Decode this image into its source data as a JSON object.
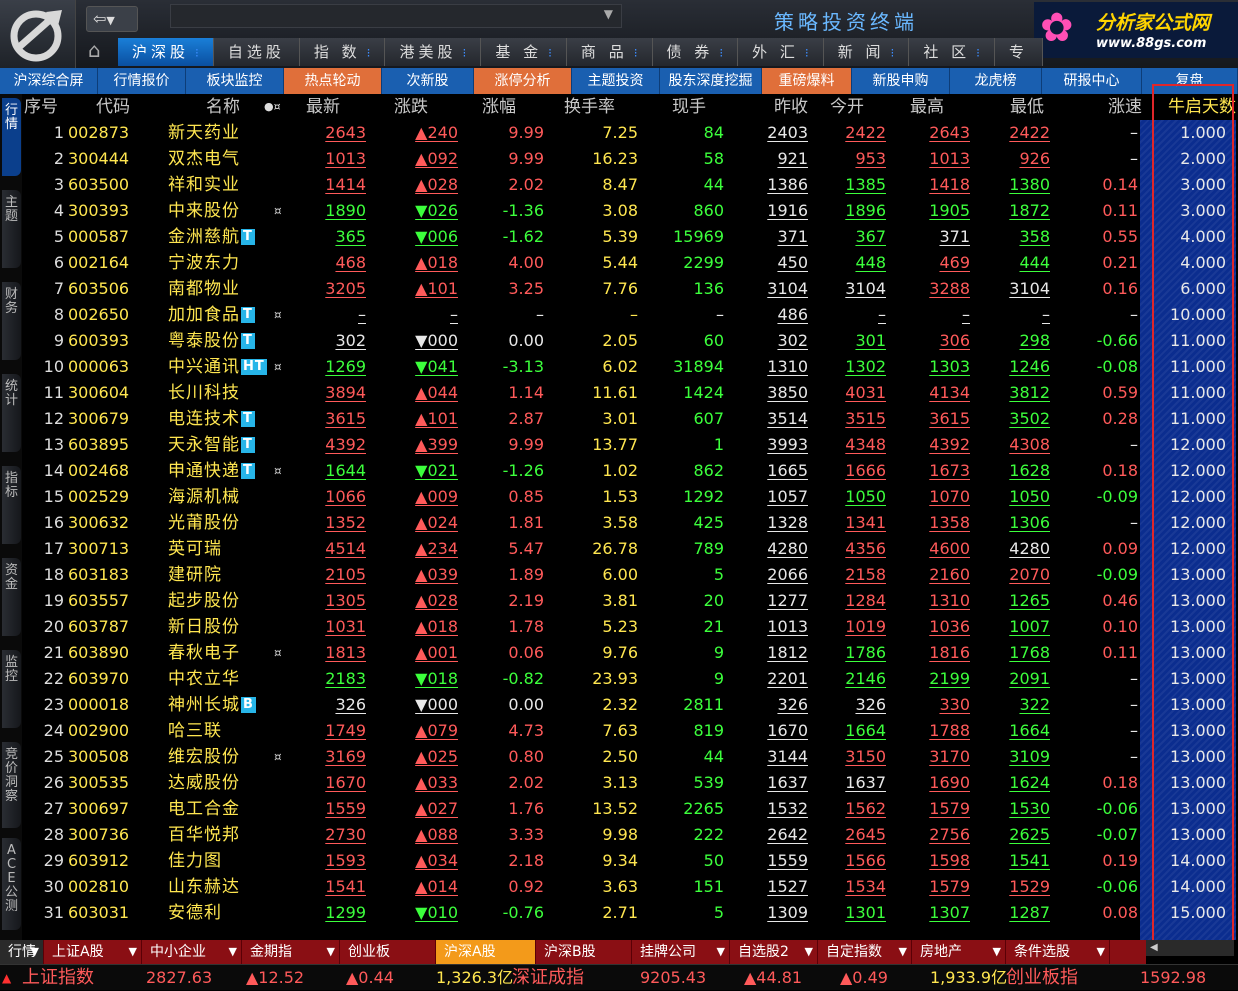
{
  "titlebar": {
    "terminal_title": "策略投资终端",
    "brand_name": "分析家公式网",
    "brand_url": "www.88gs.com"
  },
  "main_tabs": [
    {
      "label": "沪深股",
      "active": true,
      "menu": true
    },
    {
      "label": "自选股",
      "active": false,
      "menu": false
    },
    {
      "label": "指 数",
      "active": false,
      "menu": true
    },
    {
      "label": "港美股",
      "active": false,
      "menu": true
    },
    {
      "label": "基 金",
      "active": false,
      "menu": true
    },
    {
      "label": "商 品",
      "active": false,
      "menu": true
    },
    {
      "label": "债 券",
      "active": false,
      "menu": true
    },
    {
      "label": "外 汇",
      "active": false,
      "menu": true
    },
    {
      "label": "新 闻",
      "active": false,
      "menu": true
    },
    {
      "label": "社 区",
      "active": false,
      "menu": true
    },
    {
      "label": "专",
      "active": false,
      "menu": false
    }
  ],
  "sub_nav": [
    {
      "label": "沪深综合屏",
      "hot": false
    },
    {
      "label": "行情报价",
      "hot": false
    },
    {
      "label": "板块监控",
      "hot": false
    },
    {
      "label": "热点轮动",
      "hot": true
    },
    {
      "label": "次新股",
      "hot": false
    },
    {
      "label": "涨停分析",
      "hot": true
    },
    {
      "label": "主题投资",
      "hot": false
    },
    {
      "label": "股东深度挖掘",
      "hot": false
    },
    {
      "label": "重磅爆料",
      "hot": true
    },
    {
      "label": "新股申购",
      "hot": false
    },
    {
      "label": "龙虎榜",
      "hot": false
    },
    {
      "label": "研报中心",
      "hot": false
    },
    {
      "label": "复盘",
      "hot": false
    }
  ],
  "side_tabs": [
    "行情",
    "主题",
    "财务",
    "统计",
    "指标",
    "资金",
    "监控",
    "竞价洞察",
    "ACE公测"
  ],
  "columns": [
    "序号",
    "代码",
    "名称",
    "最新",
    "涨跌",
    "涨幅",
    "换手率",
    "现手",
    "昨收",
    "今开",
    "最高",
    "最低",
    "涨速",
    "牛启天数↑"
  ],
  "rows": [
    {
      "i": "1",
      "code": "002873",
      "name": "新天药业",
      "tag": "",
      "star": false,
      "last": "2643",
      "chg": "▲240",
      "pct": "9.99",
      "turn": "7.25",
      "vol": "84",
      "prev": "2403",
      "open": "2422",
      "high": "2643",
      "low": "2422",
      "speed": "–",
      "days": "1.000",
      "dir": "up",
      "oc": "up",
      "hc": "up",
      "lc": "up"
    },
    {
      "i": "2",
      "code": "300444",
      "name": "双杰电气",
      "tag": "",
      "star": false,
      "last": "1013",
      "chg": "▲092",
      "pct": "9.99",
      "turn": "16.23",
      "vol": "58",
      "prev": "921",
      "open": "953",
      "high": "1013",
      "low": "926",
      "speed": "–",
      "days": "2.000",
      "dir": "up",
      "oc": "up",
      "hc": "up",
      "lc": "up"
    },
    {
      "i": "3",
      "code": "603500",
      "name": "祥和实业",
      "tag": "",
      "star": false,
      "last": "1414",
      "chg": "▲028",
      "pct": "2.02",
      "turn": "8.47",
      "vol": "44",
      "prev": "1386",
      "open": "1385",
      "high": "1418",
      "low": "1380",
      "speed": "0.14",
      "days": "3.000",
      "dir": "up",
      "oc": "dn",
      "hc": "up",
      "lc": "dn"
    },
    {
      "i": "4",
      "code": "300393",
      "name": "中来股份",
      "tag": "",
      "star": true,
      "last": "1890",
      "chg": "▼026",
      "pct": "-1.36",
      "turn": "3.08",
      "vol": "860",
      "prev": "1916",
      "open": "1896",
      "high": "1905",
      "low": "1872",
      "speed": "0.11",
      "days": "3.000",
      "dir": "dn",
      "oc": "dn",
      "hc": "dn",
      "lc": "dn"
    },
    {
      "i": "5",
      "code": "000587",
      "name": "金洲慈航",
      "tag": "T",
      "star": false,
      "last": "365",
      "chg": "▼006",
      "pct": "-1.62",
      "turn": "5.39",
      "vol": "15969",
      "prev": "371",
      "open": "367",
      "high": "371",
      "low": "358",
      "speed": "0.55",
      "days": "4.000",
      "dir": "dn",
      "oc": "dn",
      "hc": "wh",
      "lc": "dn"
    },
    {
      "i": "6",
      "code": "002164",
      "name": "宁波东力",
      "tag": "",
      "star": false,
      "last": "468",
      "chg": "▲018",
      "pct": "4.00",
      "turn": "5.44",
      "vol": "2299",
      "prev": "450",
      "open": "448",
      "high": "469",
      "low": "444",
      "speed": "0.21",
      "days": "4.000",
      "dir": "up",
      "oc": "dn",
      "hc": "up",
      "lc": "dn"
    },
    {
      "i": "7",
      "code": "603506",
      "name": "南都物业",
      "tag": "",
      "star": false,
      "last": "3205",
      "chg": "▲101",
      "pct": "3.25",
      "turn": "7.76",
      "vol": "136",
      "prev": "3104",
      "open": "3104",
      "high": "3288",
      "low": "3104",
      "speed": "0.16",
      "days": "6.000",
      "dir": "up",
      "oc": "wh",
      "hc": "up",
      "lc": "wh"
    },
    {
      "i": "8",
      "code": "002650",
      "name": "加加食品",
      "tag": "T",
      "star": true,
      "last": "–",
      "chg": "–",
      "pct": "–",
      "turn": "–",
      "vol": "–",
      "prev": "486",
      "open": "–",
      "high": "–",
      "low": "–",
      "speed": "–",
      "days": "10.000",
      "dir": "wh",
      "oc": "wh",
      "hc": "wh",
      "lc": "wh"
    },
    {
      "i": "9",
      "code": "600393",
      "name": "粤泰股份",
      "tag": "T",
      "star": false,
      "last": "302",
      "chg": "▼000",
      "pct": "0.00",
      "turn": "2.05",
      "vol": "60",
      "prev": "302",
      "open": "301",
      "high": "306",
      "low": "298",
      "speed": "-0.66",
      "days": "11.000",
      "dir": "wh",
      "oc": "dn",
      "hc": "up",
      "lc": "dn"
    },
    {
      "i": "10",
      "code": "000063",
      "name": "中兴通讯",
      "tag": "HT",
      "star": true,
      "last": "1269",
      "chg": "▼041",
      "pct": "-3.13",
      "turn": "6.02",
      "vol": "31894",
      "prev": "1310",
      "open": "1302",
      "high": "1303",
      "low": "1246",
      "speed": "-0.08",
      "days": "11.000",
      "dir": "dn",
      "oc": "dn",
      "hc": "dn",
      "lc": "dn"
    },
    {
      "i": "11",
      "code": "300604",
      "name": "长川科技",
      "tag": "",
      "star": false,
      "last": "3894",
      "chg": "▲044",
      "pct": "1.14",
      "turn": "11.61",
      "vol": "1424",
      "prev": "3850",
      "open": "4031",
      "high": "4134",
      "low": "3812",
      "speed": "0.59",
      "days": "11.000",
      "dir": "up",
      "oc": "up",
      "hc": "up",
      "lc": "dn"
    },
    {
      "i": "12",
      "code": "300679",
      "name": "电连技术",
      "tag": "T",
      "star": false,
      "last": "3615",
      "chg": "▲101",
      "pct": "2.87",
      "turn": "3.01",
      "vol": "607",
      "prev": "3514",
      "open": "3515",
      "high": "3615",
      "low": "3502",
      "speed": "0.28",
      "days": "11.000",
      "dir": "up",
      "oc": "up",
      "hc": "up",
      "lc": "dn"
    },
    {
      "i": "13",
      "code": "603895",
      "name": "天永智能",
      "tag": "T",
      "star": false,
      "last": "4392",
      "chg": "▲399",
      "pct": "9.99",
      "turn": "13.77",
      "vol": "1",
      "prev": "3993",
      "open": "4348",
      "high": "4392",
      "low": "4308",
      "speed": "–",
      "days": "12.000",
      "dir": "up",
      "oc": "up",
      "hc": "up",
      "lc": "up"
    },
    {
      "i": "14",
      "code": "002468",
      "name": "申通快递",
      "tag": "T",
      "star": true,
      "last": "1644",
      "chg": "▼021",
      "pct": "-1.26",
      "turn": "1.02",
      "vol": "862",
      "prev": "1665",
      "open": "1666",
      "high": "1673",
      "low": "1628",
      "speed": "0.18",
      "days": "12.000",
      "dir": "dn",
      "oc": "up",
      "hc": "up",
      "lc": "dn"
    },
    {
      "i": "15",
      "code": "002529",
      "name": "海源机械",
      "tag": "",
      "star": false,
      "last": "1066",
      "chg": "▲009",
      "pct": "0.85",
      "turn": "1.53",
      "vol": "1292",
      "prev": "1057",
      "open": "1050",
      "high": "1070",
      "low": "1050",
      "speed": "-0.09",
      "days": "12.000",
      "dir": "up",
      "oc": "dn",
      "hc": "up",
      "lc": "dn"
    },
    {
      "i": "16",
      "code": "300632",
      "name": "光莆股份",
      "tag": "",
      "star": false,
      "last": "1352",
      "chg": "▲024",
      "pct": "1.81",
      "turn": "3.58",
      "vol": "425",
      "prev": "1328",
      "open": "1341",
      "high": "1358",
      "low": "1306",
      "speed": "–",
      "days": "12.000",
      "dir": "up",
      "oc": "up",
      "hc": "up",
      "lc": "dn"
    },
    {
      "i": "17",
      "code": "300713",
      "name": "英可瑞",
      "tag": "",
      "star": false,
      "last": "4514",
      "chg": "▲234",
      "pct": "5.47",
      "turn": "26.78",
      "vol": "789",
      "prev": "4280",
      "open": "4356",
      "high": "4600",
      "low": "4280",
      "speed": "0.09",
      "days": "12.000",
      "dir": "up",
      "oc": "up",
      "hc": "up",
      "lc": "wh"
    },
    {
      "i": "18",
      "code": "603183",
      "name": "建研院",
      "tag": "",
      "star": false,
      "last": "2105",
      "chg": "▲039",
      "pct": "1.89",
      "turn": "6.00",
      "vol": "5",
      "prev": "2066",
      "open": "2158",
      "high": "2160",
      "low": "2070",
      "speed": "-0.09",
      "days": "13.000",
      "dir": "up",
      "oc": "up",
      "hc": "up",
      "lc": "up"
    },
    {
      "i": "19",
      "code": "603557",
      "name": "起步股份",
      "tag": "",
      "star": false,
      "last": "1305",
      "chg": "▲028",
      "pct": "2.19",
      "turn": "3.81",
      "vol": "20",
      "prev": "1277",
      "open": "1284",
      "high": "1310",
      "low": "1265",
      "speed": "0.46",
      "days": "13.000",
      "dir": "up",
      "oc": "up",
      "hc": "up",
      "lc": "dn"
    },
    {
      "i": "20",
      "code": "603787",
      "name": "新日股份",
      "tag": "",
      "star": false,
      "last": "1031",
      "chg": "▲018",
      "pct": "1.78",
      "turn": "5.23",
      "vol": "21",
      "prev": "1013",
      "open": "1019",
      "high": "1036",
      "low": "1007",
      "speed": "0.10",
      "days": "13.000",
      "dir": "up",
      "oc": "up",
      "hc": "up",
      "lc": "dn"
    },
    {
      "i": "21",
      "code": "603890",
      "name": "春秋电子",
      "tag": "",
      "star": true,
      "last": "1813",
      "chg": "▲001",
      "pct": "0.06",
      "turn": "9.76",
      "vol": "9",
      "prev": "1812",
      "open": "1786",
      "high": "1816",
      "low": "1768",
      "speed": "0.11",
      "days": "13.000",
      "dir": "up",
      "oc": "dn",
      "hc": "up",
      "lc": "dn"
    },
    {
      "i": "22",
      "code": "603970",
      "name": "中农立华",
      "tag": "",
      "star": false,
      "last": "2183",
      "chg": "▼018",
      "pct": "-0.82",
      "turn": "23.93",
      "vol": "9",
      "prev": "2201",
      "open": "2146",
      "high": "2199",
      "low": "2091",
      "speed": "–",
      "days": "13.000",
      "dir": "dn",
      "oc": "dn",
      "hc": "dn",
      "lc": "dn"
    },
    {
      "i": "23",
      "code": "000018",
      "name": "神州长城",
      "tag": "B",
      "star": false,
      "last": "326",
      "chg": "▼000",
      "pct": "0.00",
      "turn": "2.32",
      "vol": "2811",
      "prev": "326",
      "open": "326",
      "high": "330",
      "low": "322",
      "speed": "–",
      "days": "13.000",
      "dir": "wh",
      "oc": "wh",
      "hc": "up",
      "lc": "dn"
    },
    {
      "i": "24",
      "code": "002900",
      "name": "哈三联",
      "tag": "",
      "star": false,
      "last": "1749",
      "chg": "▲079",
      "pct": "4.73",
      "turn": "7.63",
      "vol": "819",
      "prev": "1670",
      "open": "1664",
      "high": "1788",
      "low": "1664",
      "speed": "–",
      "days": "13.000",
      "dir": "up",
      "oc": "dn",
      "hc": "up",
      "lc": "dn"
    },
    {
      "i": "25",
      "code": "300508",
      "name": "维宏股份",
      "tag": "",
      "star": true,
      "last": "3169",
      "chg": "▲025",
      "pct": "0.80",
      "turn": "2.50",
      "vol": "44",
      "prev": "3144",
      "open": "3150",
      "high": "3170",
      "low": "3109",
      "speed": "–",
      "days": "13.000",
      "dir": "up",
      "oc": "up",
      "hc": "up",
      "lc": "dn"
    },
    {
      "i": "26",
      "code": "300535",
      "name": "达威股份",
      "tag": "",
      "star": false,
      "last": "1670",
      "chg": "▲033",
      "pct": "2.02",
      "turn": "3.13",
      "vol": "539",
      "prev": "1637",
      "open": "1637",
      "high": "1690",
      "low": "1624",
      "speed": "0.18",
      "days": "13.000",
      "dir": "up",
      "oc": "wh",
      "hc": "up",
      "lc": "dn"
    },
    {
      "i": "27",
      "code": "300697",
      "name": "电工合金",
      "tag": "",
      "star": false,
      "last": "1559",
      "chg": "▲027",
      "pct": "1.76",
      "turn": "13.52",
      "vol": "2265",
      "prev": "1532",
      "open": "1562",
      "high": "1579",
      "low": "1530",
      "speed": "-0.06",
      "days": "13.000",
      "dir": "up",
      "oc": "up",
      "hc": "up",
      "lc": "dn"
    },
    {
      "i": "28",
      "code": "300736",
      "name": "百华悦邦",
      "tag": "",
      "star": false,
      "last": "2730",
      "chg": "▲088",
      "pct": "3.33",
      "turn": "9.98",
      "vol": "222",
      "prev": "2642",
      "open": "2645",
      "high": "2756",
      "low": "2625",
      "speed": "-0.07",
      "days": "13.000",
      "dir": "up",
      "oc": "up",
      "hc": "up",
      "lc": "dn"
    },
    {
      "i": "29",
      "code": "603912",
      "name": "佳力图",
      "tag": "",
      "star": false,
      "last": "1593",
      "chg": "▲034",
      "pct": "2.18",
      "turn": "9.34",
      "vol": "50",
      "prev": "1559",
      "open": "1566",
      "high": "1598",
      "low": "1541",
      "speed": "0.19",
      "days": "14.000",
      "dir": "up",
      "oc": "up",
      "hc": "up",
      "lc": "dn"
    },
    {
      "i": "30",
      "code": "002810",
      "name": "山东赫达",
      "tag": "",
      "star": false,
      "last": "1541",
      "chg": "▲014",
      "pct": "0.92",
      "turn": "3.63",
      "vol": "151",
      "prev": "1527",
      "open": "1534",
      "high": "1579",
      "low": "1529",
      "speed": "-0.06",
      "days": "14.000",
      "dir": "up",
      "oc": "up",
      "hc": "up",
      "lc": "up"
    },
    {
      "i": "31",
      "code": "603031",
      "name": "安德利",
      "tag": "",
      "star": false,
      "last": "1299",
      "chg": "▼010",
      "pct": "-0.76",
      "turn": "2.71",
      "vol": "5",
      "prev": "1309",
      "open": "1301",
      "high": "1307",
      "low": "1287",
      "speed": "0.08",
      "days": "15.000",
      "dir": "dn",
      "oc": "dn",
      "hc": "dn",
      "lc": "dn"
    }
  ],
  "bottom_tabs": [
    {
      "label": "行情",
      "menu": true,
      "active": false
    },
    {
      "label": "上证A股",
      "menu": true,
      "active": false
    },
    {
      "label": "中小企业",
      "menu": true,
      "active": false
    },
    {
      "label": "金期指",
      "menu": true,
      "active": false
    },
    {
      "label": "创业板",
      "menu": false,
      "active": false
    },
    {
      "label": "沪深A股",
      "menu": false,
      "active": true
    },
    {
      "label": "沪深B股",
      "menu": false,
      "active": false
    },
    {
      "label": "挂牌公司",
      "menu": true,
      "active": false
    },
    {
      "label": "自选股2",
      "menu": true,
      "active": false
    },
    {
      "label": "自定指数",
      "menu": true,
      "active": false
    },
    {
      "label": "房地产",
      "menu": true,
      "active": false
    },
    {
      "label": "条件选股",
      "menu": true,
      "active": false
    }
  ],
  "status_bar": {
    "idx1_name": "上证指数",
    "idx1_value": "2827.63",
    "idx1_change": "▲12.52",
    "idx1_pct": "▲0.44",
    "idx1_amount": "1,326.3亿",
    "idx2_name": "深证成指",
    "idx2_value": "9205.43",
    "idx2_change": "▲44.81",
    "idx2_pct": "▲0.49",
    "idx2_amount": "1,933.9亿",
    "idx3_name": "创业板指",
    "idx3_value": "1592.98"
  },
  "colors": {
    "up": "#ff5a5a",
    "down": "#3cff3c",
    "code": "#ffe650",
    "accent": "#1a5fb0",
    "highlight_border": "#e0262a"
  }
}
